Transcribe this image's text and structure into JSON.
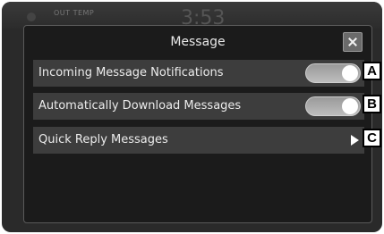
{
  "background": {
    "temp_label": "OUT TEMP",
    "clock": "3:53"
  },
  "dialog": {
    "title": "Message",
    "close_icon": "close-icon"
  },
  "rows": [
    {
      "label": "Incoming Message Notifications",
      "control": "toggle",
      "state": "on",
      "callout": "A"
    },
    {
      "label": "Automatically Download Messages",
      "control": "toggle",
      "state": "on",
      "callout": "B"
    },
    {
      "label": "Quick Reply Messages",
      "control": "arrow",
      "icon": "chevron-right-icon",
      "callout": "C"
    }
  ],
  "colors": {
    "dialog_bg": "#1b1b1b",
    "row_bg": "#3d3d3d",
    "text": "#ececec"
  }
}
